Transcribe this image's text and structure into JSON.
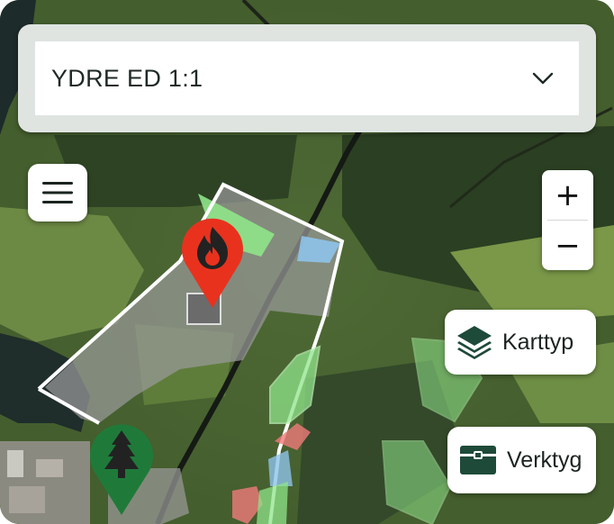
{
  "area_select": {
    "value": "YDRE ED 1:1",
    "chevron_icon": "chevron-down-icon"
  },
  "menu": {
    "icon": "hamburger-menu-icon"
  },
  "zoom": {
    "in_label": "+",
    "out_label": "−"
  },
  "karttyp": {
    "label": "Karttyp",
    "icon": "layers-icon"
  },
  "verktyg": {
    "label": "Verktyg",
    "icon": "toolbox-icon"
  },
  "markers": [
    {
      "name": "fire-marker",
      "icon": "flame-icon",
      "color": "#e8321e"
    },
    {
      "name": "forest-marker",
      "icon": "tree-icon",
      "color": "#1f7a3a"
    }
  ],
  "colors": {
    "property_outline": "#ffffff",
    "stand_green": "#8fe48a",
    "stand_red": "#f07a7a",
    "stand_blue": "#8ec3ea",
    "stand_grey": "#9a9a9a"
  }
}
